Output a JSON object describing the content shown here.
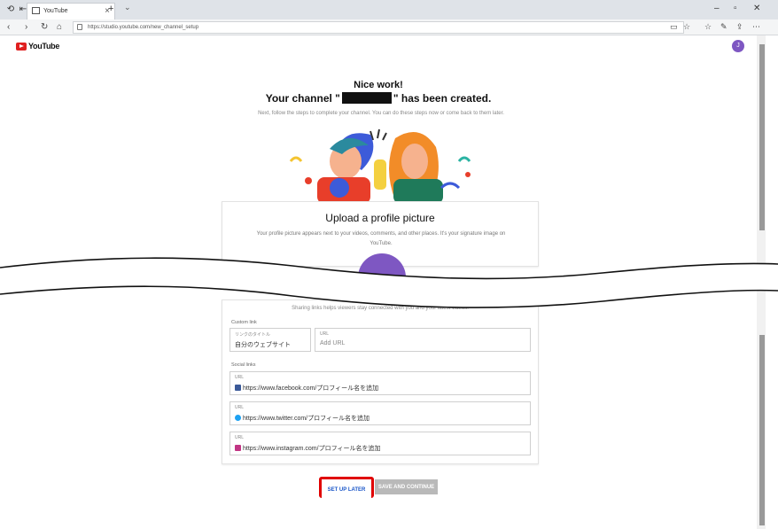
{
  "browser": {
    "tab_title": "YouTube",
    "new_tab": "+",
    "tab_dropdown": "⌄",
    "url": "https://studio.youtube.com/new_channel_setup",
    "window_min": "–",
    "window_max": "▫",
    "window_close": "✕"
  },
  "header": {
    "logo_text": "YouTube",
    "avatar_letter": "J"
  },
  "hero": {
    "heading": "Nice work!",
    "created_before": "Your channel \"",
    "created_after": "\" has been created.",
    "subtext": "Next, follow the steps to complete your channel. You can do these steps now or come back to them later."
  },
  "profile_card": {
    "title": "Upload a profile picture",
    "description": "Your profile picture appears next to your videos, comments, and other places. It's your signature image on YouTube."
  },
  "links_card": {
    "sharing_text": "Sharing links helps viewers stay connected with you and your latest videos.",
    "custom_section": "Custom link",
    "link_title_label": "リンクのタイトル",
    "link_title_value": "自分のウェブサイト",
    "url_label": "URL",
    "url_placeholder": "Add URL",
    "social_section": "Social links",
    "social": [
      {
        "label": "URL",
        "value": "https://www.facebook.com/プロフィール名を追加"
      },
      {
        "label": "URL",
        "value": "https://www.twitter.com/プロフィール名を追加"
      },
      {
        "label": "URL",
        "value": "https://www.instagram.com/プロフィール名を追加"
      }
    ]
  },
  "actions": {
    "set_up_later": "SET UP LATER",
    "save_continue": "SAVE AND CONTINUE"
  },
  "colors": {
    "highlight": "#e00000",
    "purple": "#7e57c2",
    "link_blue": "#1a56c8",
    "yt_red": "#e02020"
  }
}
